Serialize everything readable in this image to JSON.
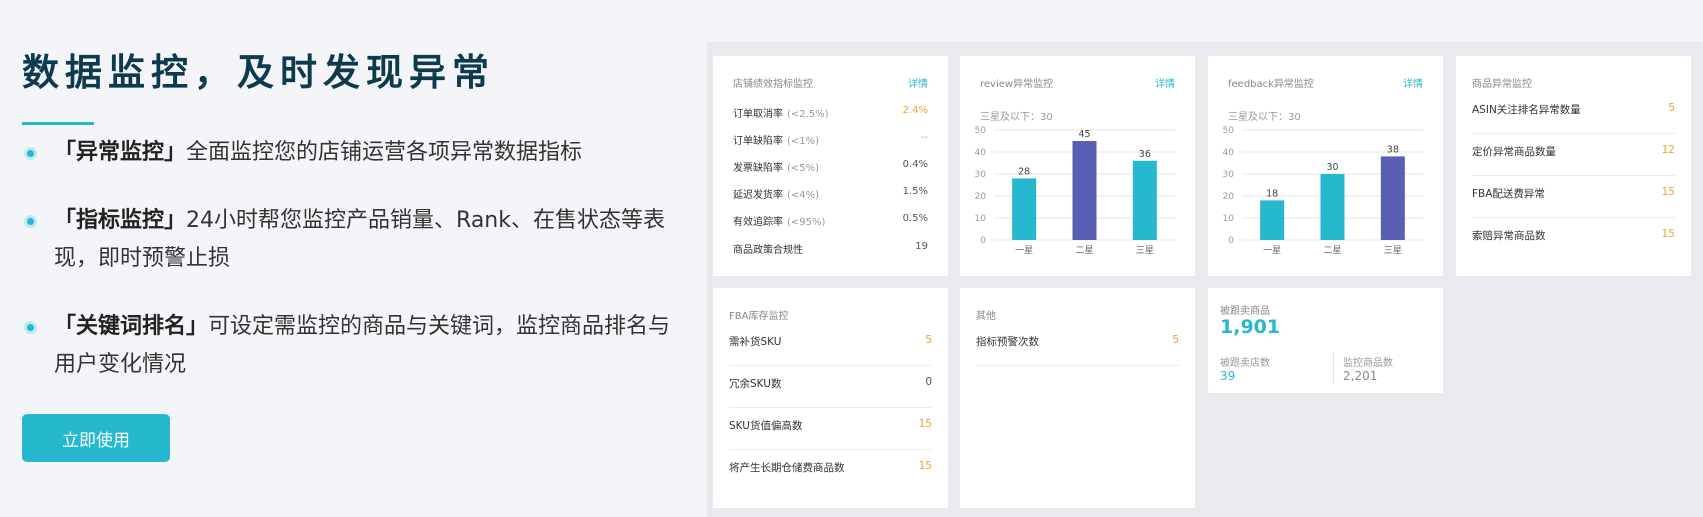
{
  "hero": {
    "title": "数据监控，及时发现异常",
    "features": [
      {
        "highlight": "「异常监控」",
        "text": "全面监控您的店铺运营各项异常数据指标"
      },
      {
        "highlight": "「指标监控」",
        "text": "24小时帮您监控产品销量、Rank、在售状态等表现，即时预警止损"
      },
      {
        "highlight": "「关键词排名」",
        "text": "可设定需监控的商品与关键词，监控商品排名与用户变化情况"
      }
    ],
    "cta_label": "立即使用"
  },
  "colors": {
    "accent": "#26b8cf",
    "purple": "#5b5fb3",
    "orange": "#f0a030",
    "title": "#0e3a4e"
  },
  "store_card": {
    "title": "店铺绩效指标监控",
    "link": "详情",
    "rows": [
      {
        "label": "订单取消率",
        "cond": "(<2.5%)",
        "value": "2.4%"
      },
      {
        "label": "订单缺陷率",
        "cond": "(<1%)",
        "value": "--"
      },
      {
        "label": "发票缺陷率",
        "cond": "(<5%)",
        "value": "0.4%"
      },
      {
        "label": "延迟发货率",
        "cond": "(<4%)",
        "value": "1.5%"
      },
      {
        "label": "有效追踪率",
        "cond": "(<95%)",
        "value": "0.5%"
      },
      {
        "label": "商品政策合规性",
        "cond": "",
        "value": "19"
      }
    ]
  },
  "review_card": {
    "title": "review异常监控",
    "link": "详情",
    "subtitle": "三星及以下：30"
  },
  "feedback_card": {
    "title": "feedback异常监控",
    "link": "详情",
    "subtitle": "三星及以下：30"
  },
  "product_card": {
    "title": "商品异常监控",
    "rows": [
      {
        "label": "ASIN关注排名异常数量",
        "value": "5"
      },
      {
        "label": "定价异常商品数量",
        "value": "12"
      },
      {
        "label": "FBA配送费异常",
        "value": "15"
      },
      {
        "label": "索赔异常商品数",
        "value": "15"
      }
    ]
  },
  "fba_card": {
    "title": "FBA库存监控",
    "rows": [
      {
        "label": "需补货SKU",
        "value": "5"
      },
      {
        "label": "冗余SKU数",
        "value": "0"
      },
      {
        "label": "SKU货值偏高数",
        "value": "15"
      },
      {
        "label": "将产生长期仓储费商品数",
        "value": "15"
      }
    ]
  },
  "other_card": {
    "title": "其他",
    "rows": [
      {
        "label": "指标预警次数",
        "value": "5"
      }
    ]
  },
  "follow_card": {
    "main_label": "被跟卖商品",
    "main_value": "1,901",
    "stores_label": "被跟卖店数",
    "stores_value": "39",
    "monitored_label": "监控商品数",
    "monitored_value": "2,201"
  },
  "chart_data": [
    {
      "type": "bar",
      "categories": [
        "一星",
        "二星",
        "三星"
      ],
      "values": [
        28,
        45,
        36
      ],
      "colors": [
        "#26b8cf",
        "#5b5fb3",
        "#26b8cf"
      ],
      "ylim": [
        0,
        50
      ],
      "yticks": [
        0,
        10,
        20,
        30,
        40,
        50
      ],
      "grid": true
    },
    {
      "type": "bar",
      "categories": [
        "一星",
        "二星",
        "三星"
      ],
      "values": [
        18,
        30,
        38
      ],
      "colors": [
        "#26b8cf",
        "#26b8cf",
        "#5b5fb3"
      ],
      "ylim": [
        0,
        50
      ],
      "yticks": [
        0,
        10,
        20,
        30,
        40,
        50
      ],
      "grid": true
    }
  ]
}
